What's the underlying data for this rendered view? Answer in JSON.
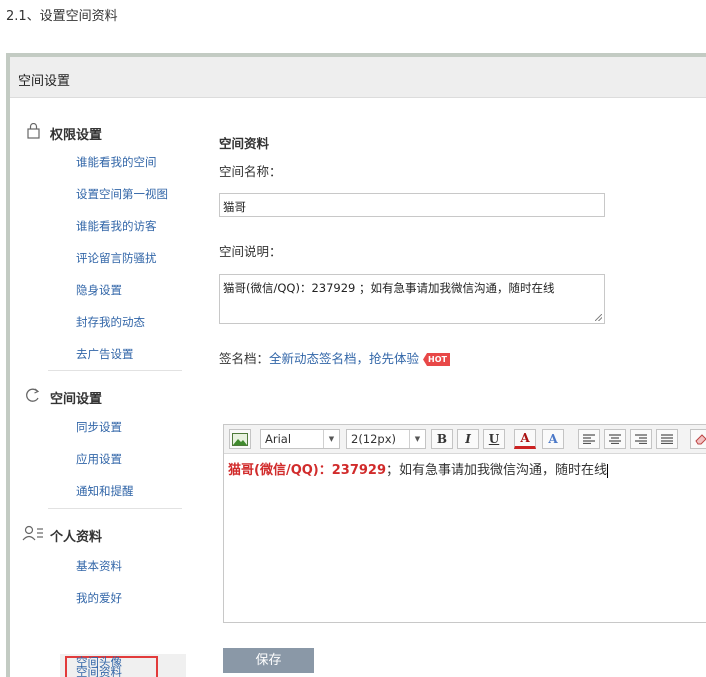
{
  "doc": {
    "caption": "2.1、设置空间资料"
  },
  "window": {
    "title": "空间设置"
  },
  "sidebar": {
    "sections": [
      {
        "title": "权限设置",
        "icon": "lock-icon",
        "items": [
          "谁能看我的空间",
          "设置空间第一视图",
          "谁能看我的访客",
          "评论留言防骚扰",
          "隐身设置",
          "封存我的动态",
          "去广告设置"
        ]
      },
      {
        "title": "空间设置",
        "icon": "sync-icon",
        "items": [
          "同步设置",
          "应用设置",
          "通知和提醒"
        ]
      },
      {
        "title": "个人资料",
        "icon": "user-icon",
        "items": [
          "基本资料",
          "我的爱好",
          "空间资料",
          "空间头像"
        ]
      }
    ],
    "active_item": "空间资料"
  },
  "main": {
    "section_title": "空间资料",
    "name_label": "空间名称：",
    "name_value": "猫哥",
    "desc_label": "空间说明：",
    "desc_value": "猫哥(微信/QQ)：237929 ；如有急事请加我微信沟通，随时在线",
    "sig_label": "签名档：",
    "sig_link": "全新动态签名档，抢先体验",
    "hot_badge": "HOT",
    "save_label": "保存"
  },
  "toolbar": {
    "font": "Arial",
    "size": "2(12px)",
    "bold": "B",
    "italic": "I",
    "underline": "U",
    "font_color": "A",
    "highlight": "A"
  },
  "editor": {
    "sig_red": "猫哥(微信/QQ)：237929",
    "sig_rest": "；如有急事请加我微信沟通，随时在线"
  }
}
